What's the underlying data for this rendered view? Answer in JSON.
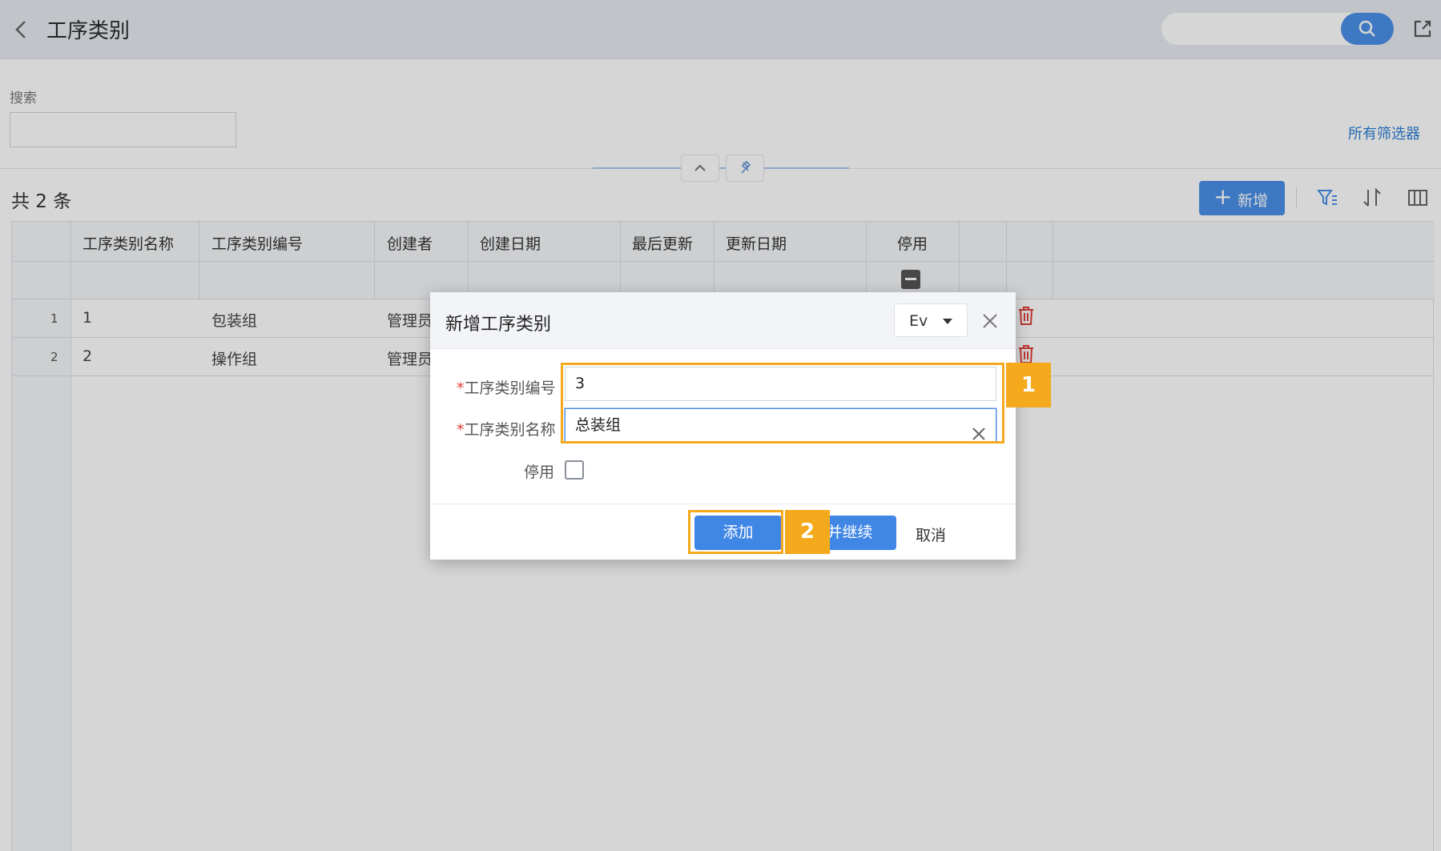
{
  "header": {
    "title": "工序类别"
  },
  "search": {
    "label": "搜索",
    "value": "",
    "placeholder": ""
  },
  "filters": {
    "all_filters": "所有筛选器"
  },
  "toolbar": {
    "total": "共 2 条",
    "add_new": "新增"
  },
  "table": {
    "columns": [
      "工序类别名称",
      "工序类别编号",
      "创建者",
      "创建日期",
      "最后更新",
      "更新日期",
      "停用"
    ],
    "rows": [
      {
        "index": "1",
        "name": "1",
        "code": "包装组",
        "creator": "管理员"
      },
      {
        "index": "2",
        "name": "2",
        "code": "操作组",
        "creator": "管理员"
      }
    ]
  },
  "dialog": {
    "title": "新增工序类别",
    "language": "Ev",
    "required_mark": "*",
    "fields": {
      "code_label": "工序类别编号",
      "code_value": "3",
      "name_label": "工序类别名称",
      "name_value": "总装组",
      "disabled_label": "停用"
    },
    "buttons": {
      "add": "添加",
      "add_continue": "加并继续",
      "cancel": "取消"
    }
  },
  "callouts": {
    "step1": "1",
    "step2": "2"
  },
  "colors": {
    "primary": "#3f86e5",
    "highlight": "#f5a91c",
    "danger": "#e0403a"
  }
}
